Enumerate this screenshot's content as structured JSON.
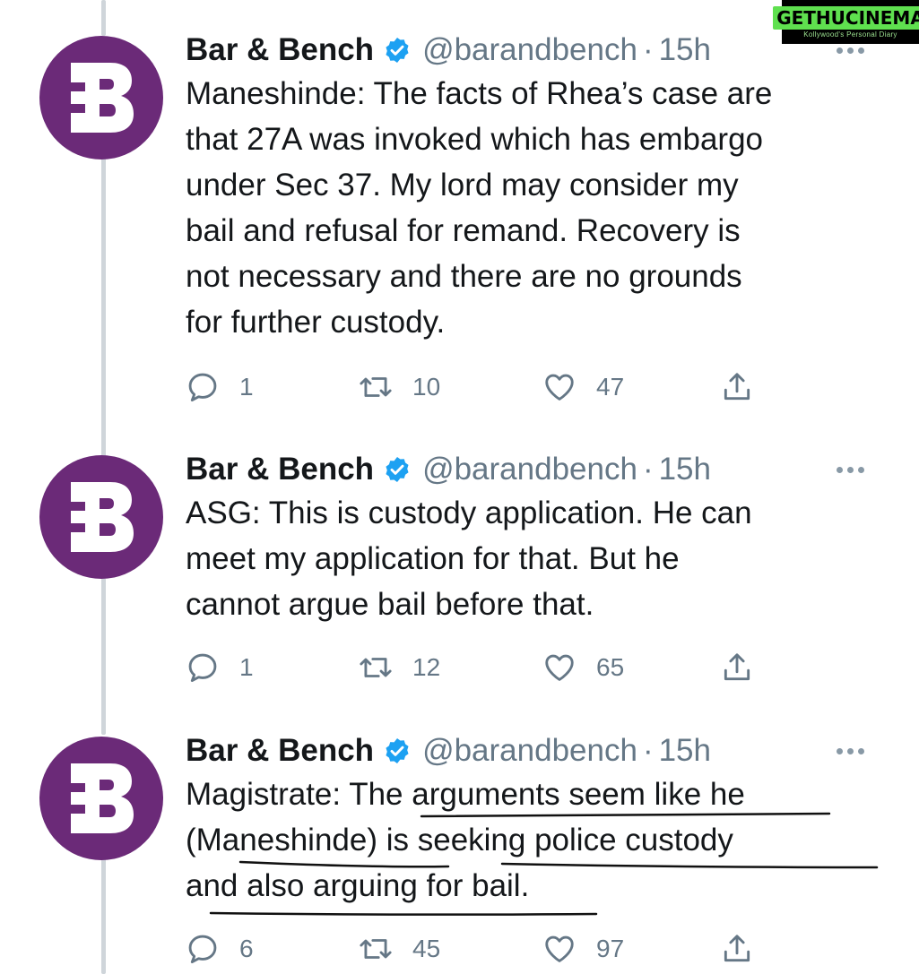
{
  "watermark": {
    "brand": "GETHUCINEMA",
    "tagline": "Kollywood's Personal Diary"
  },
  "tweets": [
    {
      "name": "Bar & Bench",
      "handle": "@barandbench",
      "separator": "·",
      "time": "15h",
      "text": "Maneshinde: The facts of Rhea’s case are\nthat 27A was invoked which has embargo\nunder Sec 37. My lord may consider my\nbail and refusal for remand. Recovery is\nnot necessary and there are no grounds\nfor further custody.",
      "replies": "1",
      "retweets": "10",
      "likes": "47"
    },
    {
      "name": "Bar & Bench",
      "handle": "@barandbench",
      "separator": "·",
      "time": "15h",
      "text": "ASG: This is custody application. He can\nmeet my application for that. But he\ncannot argue bail before that.",
      "replies": "1",
      "retweets": "12",
      "likes": "65"
    },
    {
      "name": "Bar & Bench",
      "handle": "@barandbench",
      "separator": "·",
      "time": "15h",
      "text": "Magistrate: The arguments seem like he\n(Maneshinde) is seeking police custody\nand also arguing for bail.",
      "replies": "6",
      "retweets": "45",
      "likes": "97"
    }
  ],
  "colors": {
    "avatar": "#6b2a78",
    "verified": "#1da1f2",
    "muted": "#657786",
    "thread": "#cfd5da"
  },
  "icons": {
    "avatar": "bar-and-bench-logo",
    "verified": "verified-badge-icon",
    "more": "more-options-icon",
    "reply": "reply-icon",
    "retweet": "retweet-icon",
    "like": "heart-icon",
    "share": "share-icon"
  }
}
